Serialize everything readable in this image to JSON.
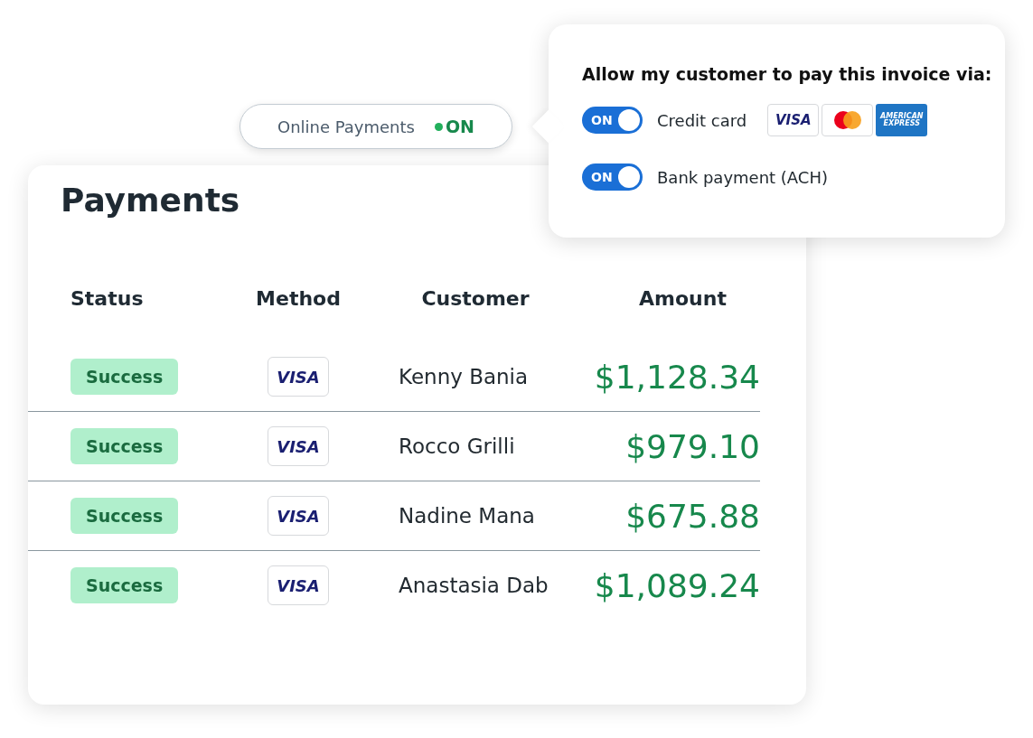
{
  "online_payments": {
    "label": "Online Payments",
    "status": "ON",
    "on": true
  },
  "popover": {
    "heading": "Allow my customer to pay this invoice via:",
    "options": [
      {
        "toggle_label": "ON",
        "on": true,
        "label": "Credit card",
        "cards": [
          {
            "kind": "visa",
            "label": "VISA"
          },
          {
            "kind": "mastercard"
          },
          {
            "kind": "amex",
            "label": "AMERICAN EXPRESS"
          }
        ]
      },
      {
        "toggle_label": "ON",
        "on": true,
        "label": "Bank payment (ACH)"
      }
    ]
  },
  "payments": {
    "title": "Payments",
    "columns": [
      "Status",
      "Method",
      "Customer",
      "Amount"
    ],
    "rows": [
      {
        "status": "Success",
        "method": "VISA",
        "customer": "Kenny Bania",
        "amount": "$1,128.34"
      },
      {
        "status": "Success",
        "method": "VISA",
        "customer": "Rocco Grilli",
        "amount": "$979.10"
      },
      {
        "status": "Success",
        "method": "VISA",
        "customer": "Nadine Mana",
        "amount": "$675.88"
      },
      {
        "status": "Success",
        "method": "VISA",
        "customer": "Anastasia Dab",
        "amount": "$1,089.24"
      }
    ]
  }
}
